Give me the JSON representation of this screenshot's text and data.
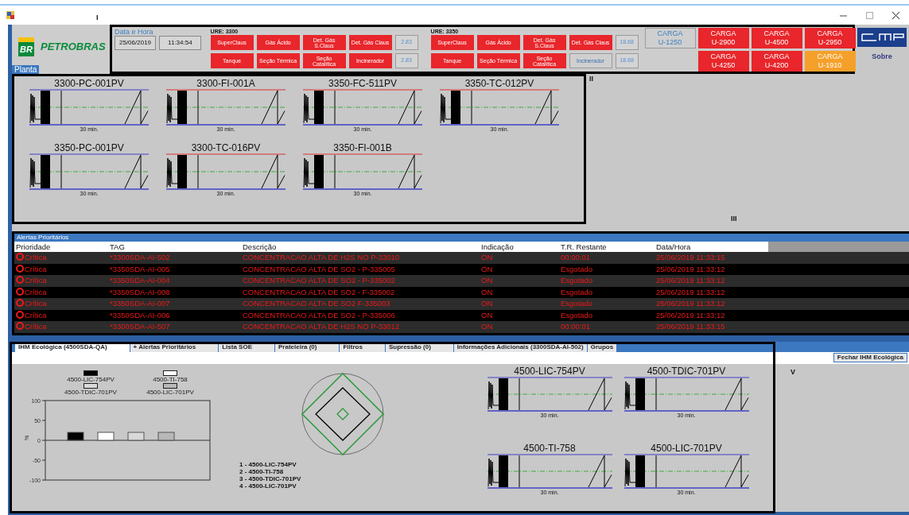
{
  "window": {
    "marker": "I"
  },
  "header": {
    "logo_mark": "BR",
    "brand": "PETROBRAS",
    "plant_tab": "Planta",
    "datetime_label": "Data e Hora",
    "date": "25/06/2019",
    "time": "11:34:54",
    "units": [
      {
        "title": "URE: 3300",
        "rows": [
          {
            "buttons": [
              {
                "label": "SuperClaus",
                "alarm": true
              },
              {
                "label": "Gás Ácido",
                "alarm": true
              },
              {
                "label": "Det. Gás S.Claus",
                "alarm": true
              },
              {
                "label": "Det. Gás Claus",
                "alarm": true
              }
            ],
            "reading": "2.83"
          },
          {
            "buttons": [
              {
                "label": "Tanque",
                "alarm": true
              },
              {
                "label": "Seção Térmica",
                "alarm": true
              },
              {
                "label": "Seção Catalítica",
                "alarm": true
              },
              {
                "label": "Incinerador",
                "alarm": true
              }
            ],
            "reading": "2.83"
          }
        ]
      },
      {
        "title": "URE: 3350",
        "rows": [
          {
            "buttons": [
              {
                "label": "SuperClaus",
                "alarm": true
              },
              {
                "label": "Gás Ácido",
                "alarm": true
              },
              {
                "label": "Det. Gás S.Claus",
                "alarm": true
              },
              {
                "label": "Det. Gás Claus",
                "alarm": true
              }
            ],
            "reading": "18.68"
          },
          {
            "buttons": [
              {
                "label": "Tanque",
                "alarm": true
              },
              {
                "label": "Seção Térmica",
                "alarm": true
              },
              {
                "label": "Seção Catalítica",
                "alarm": true
              },
              {
                "label": "Incinerador",
                "alarm": false
              }
            ],
            "reading": "18.68"
          }
        ]
      }
    ],
    "loads": [
      {
        "title": "CARGA",
        "unit": "U-1250",
        "alarm": false,
        "warning": false
      },
      {
        "title": "CARGA",
        "unit": "U-2900",
        "alarm": true,
        "warning": false
      },
      {
        "title": "CARGA",
        "unit": "U-4500",
        "alarm": true,
        "warning": false
      },
      {
        "title": "CARGA",
        "unit": "U-2950",
        "alarm": true,
        "warning": false
      },
      {
        "title": "CARGA",
        "unit": "U-4250",
        "alarm": true,
        "warning": false
      },
      {
        "title": "CARGA",
        "unit": "U-4200",
        "alarm": true,
        "warning": false
      },
      {
        "title": "CARGA",
        "unit": "U-1910",
        "alarm": true,
        "warning": true
      }
    ],
    "about": "Sobre"
  },
  "plant_trends": {
    "markers": [
      "II",
      "III"
    ],
    "items": [
      {
        "tag": "3300-PC-001PV",
        "span": "30 min."
      },
      {
        "tag": "3300-FI-001A",
        "span": "30 min."
      },
      {
        "tag": "3350-FC-511PV",
        "span": "30 min."
      },
      {
        "tag": "3350-TC-012PV",
        "span": "30 min."
      },
      {
        "tag": "3350-PC-001PV",
        "span": "30 min."
      },
      {
        "tag": "3300-TC-016PV",
        "span": "30 min."
      },
      {
        "tag": "3350-FI-001B",
        "span": "30 min."
      }
    ]
  },
  "alerts": {
    "title": "Alertas Prioritários",
    "columns": [
      "Prioridade",
      "TAG",
      "Descrição",
      "Indicação",
      "T.R. Restante",
      "Data/Hora"
    ],
    "rows": [
      {
        "priority": "Crítica",
        "tag": "*3300SDA-AI-502",
        "description": "CONCENTRACAO ALTA DE H2S NO P-33010",
        "indication": "ON",
        "remaining": "00:00:01",
        "datetime": "25/06/2019 11:33:15"
      },
      {
        "priority": "Crítica",
        "tag": "*3350SDA-AI-005",
        "description": "CONCENTRACAO ALTA DE SO2 - P-335005",
        "indication": "ON",
        "remaining": "Esgotado",
        "datetime": "25/06/2019 11:33:12"
      },
      {
        "priority": "Crítica",
        "tag": "*3350SDA-AI-004",
        "description": "CONCENTRACAO ALTA DE SO2 - P-335002",
        "indication": "ON",
        "remaining": "Esgotado",
        "datetime": "25/06/2019 11:33:12"
      },
      {
        "priority": "Crítica",
        "tag": "*3350SDA-AI-008",
        "description": "CONCENTRACAO ALTA DE SO2 - F-335002",
        "indication": "ON",
        "remaining": "Esgotado",
        "datetime": "25/06/2019 11:33:12"
      },
      {
        "priority": "Crítica",
        "tag": "*3350SDA-AI-007",
        "description": "CONCENTRACAO ALTA DE SO2 F-335003",
        "indication": "ON",
        "remaining": "Esgotado",
        "datetime": "25/06/2019 11:33:12"
      },
      {
        "priority": "Crítica",
        "tag": "*3350SDA-AI-006",
        "description": "CONCENTRACAO ALTA DE SO2 - P-335006",
        "indication": "ON",
        "remaining": "Esgotado",
        "datetime": "25/06/2019 11:33:12"
      },
      {
        "priority": "Crítica",
        "tag": "*3300SDA-AI-507",
        "description": "CONCENTRACAO ALTA DE H2S NO P-33012",
        "indication": "ON",
        "remaining": "00:00:01",
        "datetime": "25/06/2019 11:33:15"
      }
    ]
  },
  "eco": {
    "tabs": [
      {
        "label": "IHM Ecológica (4500SDA-QA)",
        "selected": true
      },
      {
        "label": "+ Alertas Prioritários",
        "selected": false
      },
      {
        "label": "Lista SOE",
        "selected": false
      },
      {
        "label": "Prateleira (0)",
        "selected": false
      },
      {
        "label": "Filtros",
        "selected": false
      },
      {
        "label": "Supressão (0)",
        "selected": false
      },
      {
        "label": "Informações Adicionais (3300SDA-AI-502)",
        "selected": false
      },
      {
        "label": "Grupos",
        "selected": false
      }
    ],
    "close_button": "Fechar IHM Ecológica",
    "marker": "V",
    "bar_chart": {
      "chart_data": {
        "type": "bar",
        "ylabel": "%",
        "ylim": [
          -100,
          100
        ],
        "yticks": [
          -100,
          -50,
          0,
          50,
          100
        ],
        "series": [
          {
            "name": "4500-LIC-754PV",
            "color": "#000000",
            "values": [
              20
            ]
          },
          {
            "name": "4500-TI-758",
            "color": "#ffffff",
            "values": [
              20
            ]
          },
          {
            "name": "4500-TDIC-701PV",
            "color": "#d9d9d9",
            "values": [
              20
            ]
          },
          {
            "name": "4500-LIC-701PV",
            "color": "#b8b8b8",
            "values": [
              20
            ]
          }
        ]
      }
    },
    "radar_legend": [
      "1 - 4500-LIC-754PV",
      "2 - 4500-TI-758",
      "3 - 4500-TDIC-701PV",
      "4 - 4500-LIC-701PV"
    ],
    "trends": [
      {
        "tag": "4500-LIC-754PV",
        "span": "30 min."
      },
      {
        "tag": "4500-TDIC-701PV",
        "span": "30 min."
      },
      {
        "tag": "4500-TI-758",
        "span": "30 min."
      },
      {
        "tag": "4500-LIC-701PV",
        "span": "30 min."
      }
    ]
  }
}
